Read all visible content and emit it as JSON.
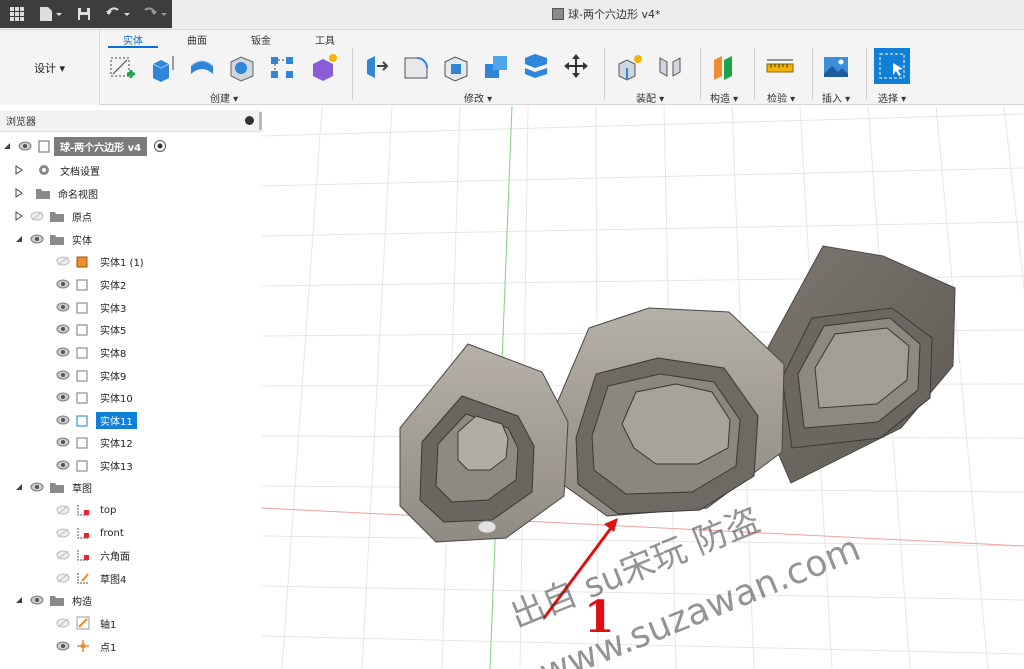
{
  "window": {
    "doc_title": "球-两个六边形 v4*"
  },
  "workspace": {
    "label": "设计 ▾"
  },
  "tabs": [
    {
      "label": "实体",
      "active": true
    },
    {
      "label": "曲面",
      "active": false
    },
    {
      "label": "钣金",
      "active": false
    },
    {
      "label": "工具",
      "active": false
    }
  ],
  "groups": {
    "create": "创建 ▾",
    "modify": "修改 ▾",
    "assemble": "装配 ▾",
    "construct": "构造 ▾",
    "inspect": "检验 ▾",
    "insert": "插入 ▾",
    "select": "选择 ▾"
  },
  "browser": {
    "title": "浏览器",
    "root": "球-两个六边形 v4",
    "items": {
      "doc_settings": "文档设置",
      "named_views": "命名视图",
      "origin": "原点",
      "bodies": "实体",
      "sketches": "草图",
      "construction": "构造"
    },
    "bodies": [
      "实体1 (1)",
      "实体2",
      "实体3",
      "实体5",
      "实体8",
      "实体9",
      "实体10",
      "实体11",
      "实体12",
      "实体13"
    ],
    "sketches": [
      "top",
      "front",
      "六角面",
      "草图4"
    ],
    "construct_items": [
      "轴1",
      "点1"
    ]
  },
  "overlay": {
    "number": "1",
    "watermark_line1": "出自 su宋玩 防盗",
    "watermark_line2": "www.suzawan.com"
  },
  "colors": {
    "accent": "#0a6fd6",
    "highlight": "#0f7fd7",
    "body": "#9a958d",
    "arrow": "#d11"
  }
}
